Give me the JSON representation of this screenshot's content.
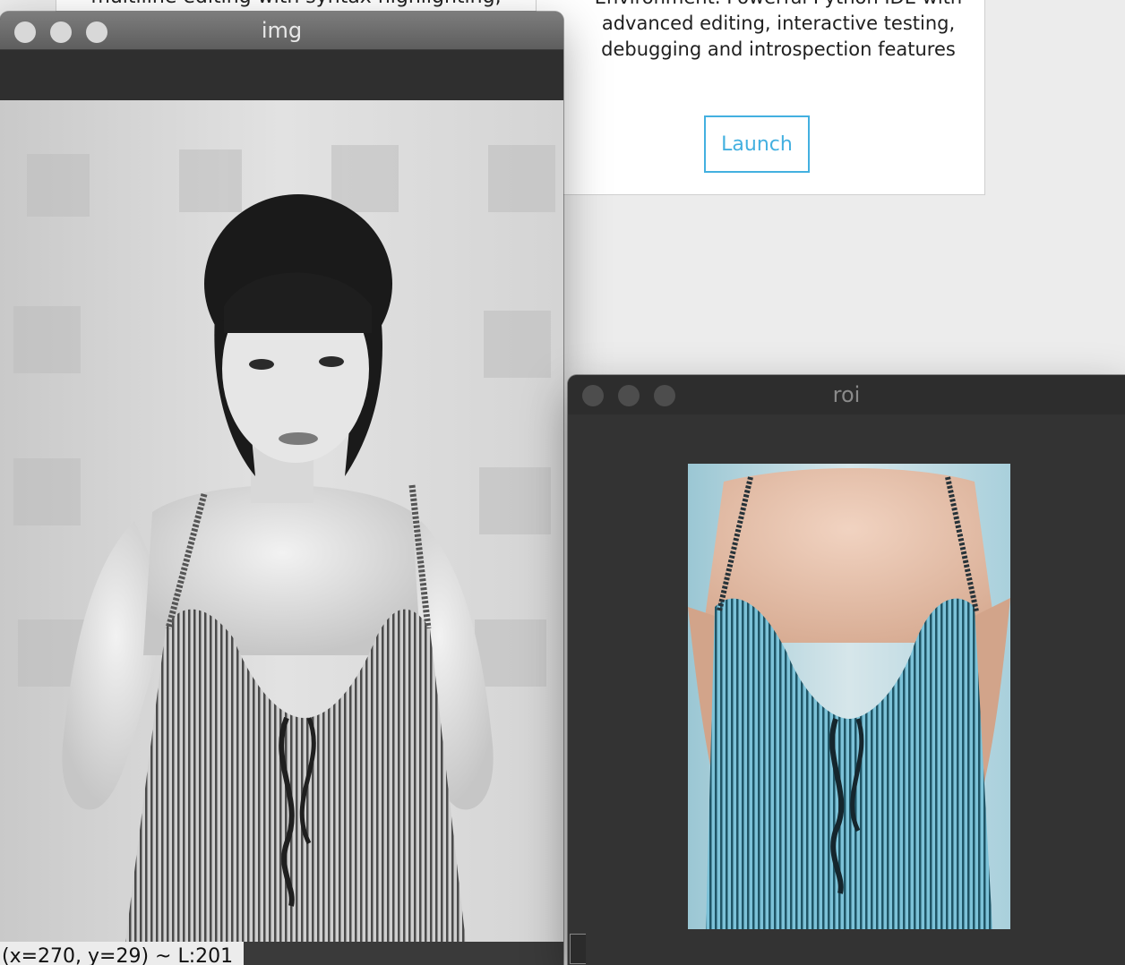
{
  "background_app": {
    "left_card_cut_text": "multiline editing with syntax highlighting,",
    "right_card_description_lines": [
      "Environment. Powerful Python IDE with",
      "advanced editing, interactive testing,",
      "debugging and introspection features"
    ],
    "launch_label": "Launch",
    "accent_color": "#43b0e0"
  },
  "img_window": {
    "title": "img",
    "status_text": "(x=270, y=29) ~ L:201",
    "image_description": "Grayscale photo of a woman in a striped lace-up swimsuit standing against a tiled wall"
  },
  "roi_window": {
    "title": "roi",
    "image_description": "Color crop of the torso region showing a light-blue striped swimsuit"
  }
}
